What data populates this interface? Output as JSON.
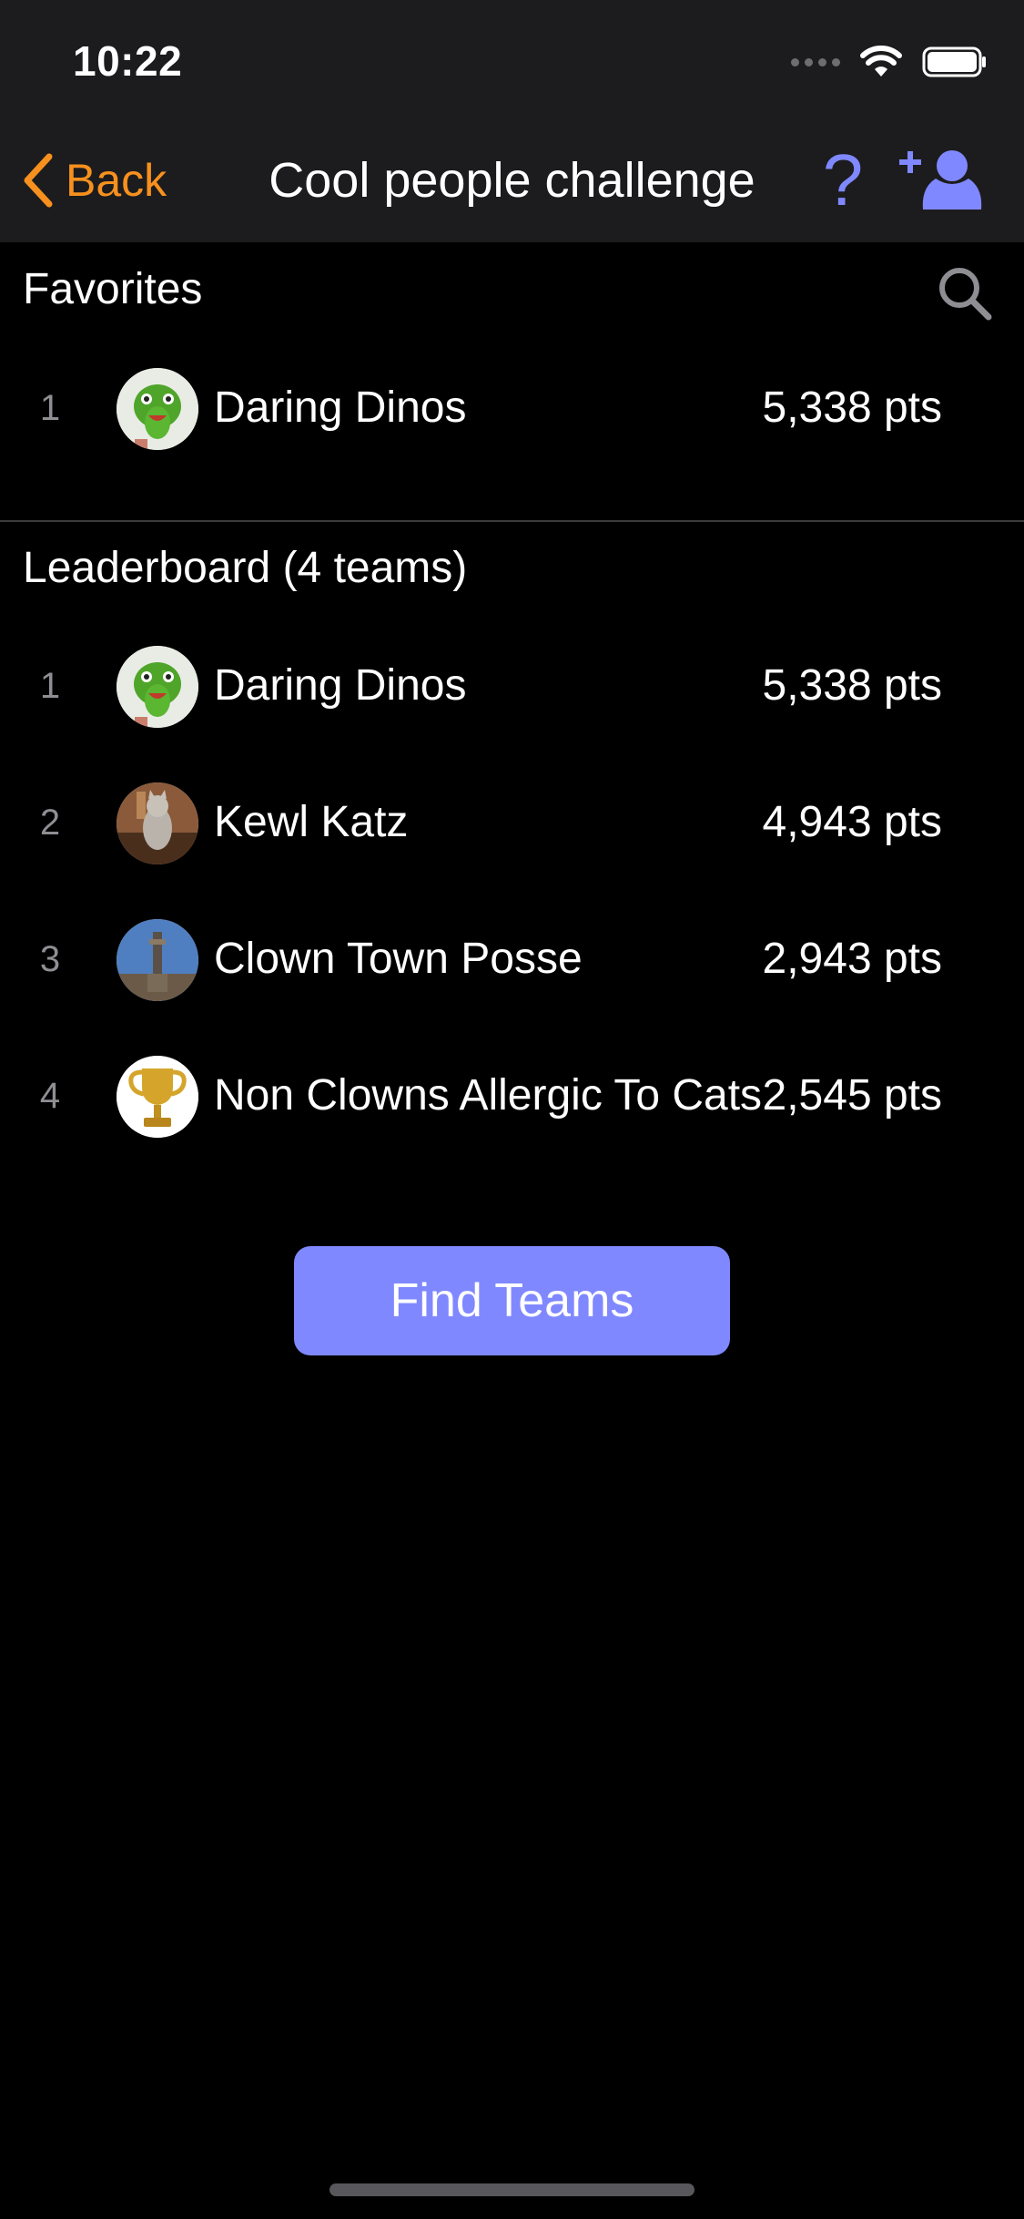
{
  "status_bar": {
    "time": "10:22"
  },
  "nav": {
    "back_label": "Back",
    "title": "Cool people challenge",
    "help_label": "?",
    "accent_color": "#8088ff",
    "back_color": "#f7901e"
  },
  "favorites": {
    "title": "Favorites",
    "rows": [
      {
        "rank": "1",
        "team": "Daring Dinos",
        "points": "5,338 pts",
        "avatar": "dino"
      }
    ]
  },
  "leaderboard": {
    "title": "Leaderboard (4 teams)",
    "rows": [
      {
        "rank": "1",
        "team": "Daring Dinos",
        "points": "5,338 pts",
        "avatar": "dino"
      },
      {
        "rank": "2",
        "team": "Kewl Katz",
        "points": "4,943 pts",
        "avatar": "cat"
      },
      {
        "rank": "3",
        "team": "Clown Town Posse",
        "points": "2,943 pts",
        "avatar": "tower"
      },
      {
        "rank": "4",
        "team": "Non Clowns Allergic To Cats",
        "points": "2,545 pts",
        "avatar": "trophy"
      }
    ]
  },
  "find_teams_label": "Find Teams"
}
